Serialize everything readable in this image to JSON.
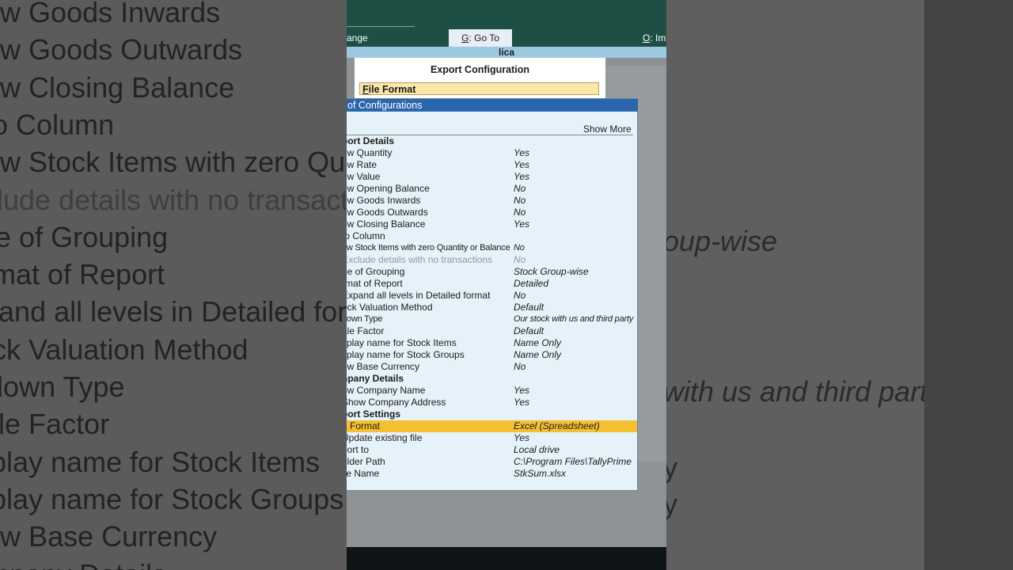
{
  "background": {
    "left_lines": [
      {
        "text": "Show Goods Inwards",
        "dim": false
      },
      {
        "text": "Show Goods Outwards",
        "dim": false
      },
      {
        "text": "Show Closing Balance",
        "dim": false
      },
      {
        "text": "Auto Column",
        "dim": false
      },
      {
        "text": "Show Stock Items with zero Quantity",
        "dim": false
      },
      {
        "text": "Exclude details with no transactions",
        "dim": true
      },
      {
        "text": "Type of Grouping",
        "dim": false
      },
      {
        "text": "Format of Report",
        "dim": false
      },
      {
        "text": "Expand all levels in Detailed format",
        "dim": false
      },
      {
        "text": "Stock Valuation Method",
        "dim": false
      },
      {
        "text": "Godown Type",
        "dim": false
      },
      {
        "text": "Scale Factor",
        "dim": false
      },
      {
        "text": "Display name for Stock Items",
        "dim": false
      },
      {
        "text": "Display name for Stock Groups",
        "dim": false
      },
      {
        "text": "Show Base Currency",
        "dim": false
      },
      {
        "text": "Company Details",
        "dim": false
      }
    ],
    "right_fragments": {
      "group_wise": "oup-wise",
      "third_party": "with us and third party",
      "tail_1": "y",
      "tail_2": "y"
    }
  },
  "topbar": {
    "left_partial": "ange",
    "goto": {
      "key": "G",
      "label": ": Go To"
    },
    "right": {
      "key": "O",
      "label": ": Imp"
    }
  },
  "title_strip": "lica",
  "export_config": {
    "title": "Export Configuration",
    "field": {
      "key": "F",
      "label": "ile Format"
    }
  },
  "config_list": {
    "header": "of Configurations",
    "show_more": "Show More",
    "rows": [
      {
        "label": "port Details",
        "value": "",
        "type": "section"
      },
      {
        "label": "ow Quantity",
        "value": "Yes"
      },
      {
        "label": "ow Rate",
        "value": "Yes"
      },
      {
        "label": "ow Value",
        "value": "Yes"
      },
      {
        "label": "ow Opening Balance",
        "value": "No"
      },
      {
        "label": "ow Goods Inwards",
        "value": "No"
      },
      {
        "label": "ow Goods Outwards",
        "value": "No"
      },
      {
        "label": "ow Closing Balance",
        "value": "Yes"
      },
      {
        "label": "to Column",
        "value": ""
      },
      {
        "label": "ow Stock Items with zero Quantity or Balance",
        "value": "No",
        "type": "small"
      },
      {
        "label": "Exclude details with no transactions",
        "value": "No",
        "type": "dim"
      },
      {
        "label": "pe of Grouping",
        "value": "Stock Group-wise"
      },
      {
        "label": "rmat of Report",
        "value": "Detailed"
      },
      {
        "label": "Expand all levels in Detailed format",
        "value": "No"
      },
      {
        "label": "ock Valuation Method",
        "value": "Default"
      },
      {
        "label": "down Type",
        "value": "Our stock with us and third party",
        "type": "small"
      },
      {
        "label": "ale Factor",
        "value": "Default"
      },
      {
        "label": "splay name for Stock Items",
        "value": "Name Only"
      },
      {
        "label": "splay name for Stock Groups",
        "value": "Name Only"
      },
      {
        "label": "ow Base Currency",
        "value": "No"
      },
      {
        "label": "npany Details",
        "value": "",
        "type": "section"
      },
      {
        "label": "ow Company Name",
        "value": "Yes"
      },
      {
        "label": "Show Company Address",
        "value": "Yes"
      },
      {
        "label": "port Settings",
        "value": "",
        "type": "section"
      },
      {
        "label": "e Format",
        "value": "Excel (Spreadsheet)",
        "type": "selected"
      },
      {
        "label": "Update existing file",
        "value": "Yes"
      },
      {
        "label": "port to",
        "value": "Local drive"
      },
      {
        "label": "older Path",
        "value": "C:\\Program Files\\TallyPrime"
      },
      {
        "label": "ile Name",
        "value": "StkSum.xlsx"
      }
    ]
  }
}
